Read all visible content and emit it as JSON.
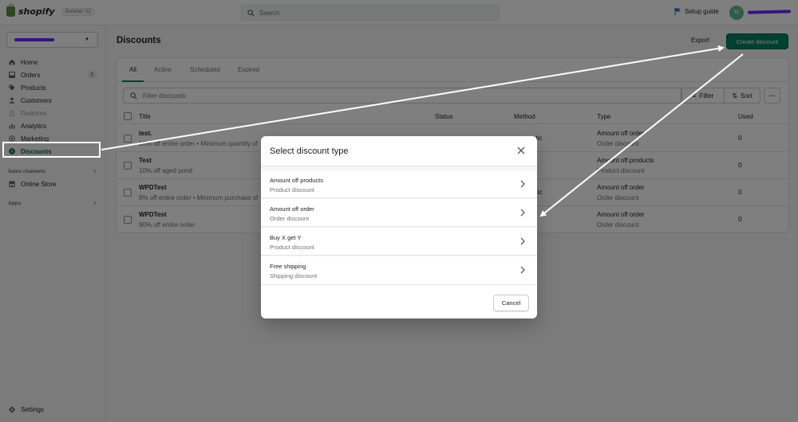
{
  "topbar": {
    "brand": "shopify",
    "edition": "Summer '22",
    "search_placeholder": "Search",
    "setup_guide": "Setup guide",
    "avatar_initials": "kt"
  },
  "sidebar": {
    "items": [
      {
        "label": "Home",
        "icon": "home-icon"
      },
      {
        "label": "Orders",
        "icon": "orders-icon",
        "badge": "1"
      },
      {
        "label": "Products",
        "icon": "tag-icon"
      },
      {
        "label": "Customers",
        "icon": "person-icon"
      },
      {
        "label": "Finances",
        "icon": "bank-icon"
      },
      {
        "label": "Analytics",
        "icon": "bar-chart-icon"
      },
      {
        "label": "Marketing",
        "icon": "target-icon"
      },
      {
        "label": "Discounts",
        "icon": "discount-icon"
      }
    ],
    "sales_channels_heading": "Sales channels",
    "online_store": "Online Store",
    "apps_heading": "Apps",
    "settings": "Settings"
  },
  "main": {
    "title": "Discounts",
    "export_label": "Export",
    "create_label": "Create discount",
    "tabs": [
      "All",
      "Active",
      "Scheduled",
      "Expired"
    ],
    "filter_placeholder": "Filter discounts",
    "filter_label": "Filter",
    "sort_label": "Sort",
    "columns": [
      "Title",
      "Status",
      "Method",
      "Type",
      "Used"
    ],
    "rows": [
      {
        "title": "test.",
        "desc": "10% off entire order • Minimum quantity of",
        "method": "atic",
        "type": "Amount off order",
        "type_sub": "Order discount",
        "used": "0"
      },
      {
        "title": "Test",
        "desc": "10% off aged pond",
        "method": "",
        "type": "Amount off products",
        "type_sub": "Product discount",
        "used": "0"
      },
      {
        "title": "WPDTest",
        "desc": "8% off entire order • Minimum purchase of",
        "method": "atic",
        "type": "Amount off order",
        "type_sub": "Order discount",
        "used": "0"
      },
      {
        "title": "WPDTest",
        "desc": "90% off entire order",
        "method": "",
        "type": "Amount off order",
        "type_sub": "Order discount",
        "used": "0"
      }
    ]
  },
  "modal": {
    "title": "Select discount type",
    "options": [
      {
        "title": "Amount off products",
        "subtitle": "Product discount"
      },
      {
        "title": "Amount off order",
        "subtitle": "Order discount"
      },
      {
        "title": "Buy X get Y",
        "subtitle": "Product discount"
      },
      {
        "title": "Free shipping",
        "subtitle": "Shipping discount"
      }
    ],
    "cancel_label": "Cancel"
  },
  "colors": {
    "primary": "#008060",
    "active_nav": "#005e46",
    "redaction": "#6a29f5",
    "annotation": "#ffffff"
  }
}
